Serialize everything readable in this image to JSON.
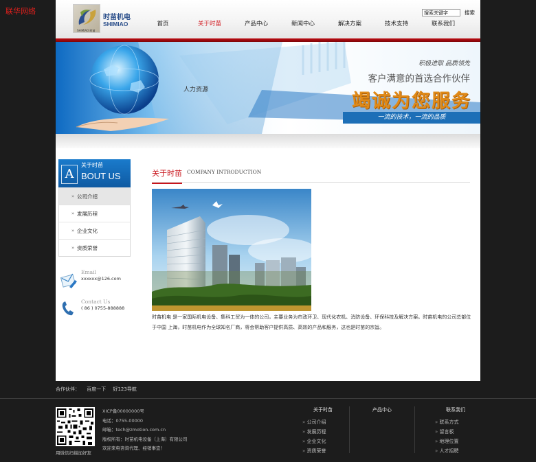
{
  "corner_brand": "联华网络",
  "logo": {
    "cn": "时苗机电",
    "en": "SHIMIAO",
    "tag": "SHIMIAO 时苗"
  },
  "nav": [
    {
      "label": "首页",
      "active": false
    },
    {
      "label": "关于时苗",
      "active": true
    },
    {
      "label": "产品中心",
      "active": false
    },
    {
      "label": "新闻中心",
      "active": false
    },
    {
      "label": "解决方案",
      "active": false
    },
    {
      "label": "技术支持",
      "active": false
    },
    {
      "label": "联系我们",
      "active": false
    }
  ],
  "search": {
    "value": "搜索关键字",
    "button": "搜索"
  },
  "banner": {
    "slogan1": "积极进取 品质领先",
    "slogan2": "客户满意的首选合作伙伴",
    "main": "竭诚为您服务",
    "strip": "一流的技术，一流的品质",
    "hr": "人力资源"
  },
  "sidebar": {
    "title_cn": "关于时苗",
    "title_letter": "A",
    "title_en": "BOUT US",
    "items": [
      {
        "label": "公司介绍",
        "active": true
      },
      {
        "label": "发展历程",
        "active": false
      },
      {
        "label": "企业文化",
        "active": false
      },
      {
        "label": "资质荣誉",
        "active": false
      }
    ],
    "email_label": "Email",
    "email_value": "xxxxxx@126.com",
    "contact_label": "Contact Us",
    "contact_value": "( 86 ) 0755-888888"
  },
  "main": {
    "title_cn": "关于时苗",
    "title_en": "COMPANY INTRODUCTION",
    "intro": "时苗机电 是一家国际机电设备、集科工贸为一体的公司，主要业务为市政环卫、现代化农机、消防设备、环保科技及解决方案。时苗机电的公司总部位于中国 上海，时苗机电作为全球知名厂商，将会帮助客户提供高质、高效的产品和服务，这也是时苗的宗旨。"
  },
  "partners": {
    "label": "合作伙伴：",
    "links": [
      "百度一下",
      "好123导航"
    ]
  },
  "footer": {
    "icp": "XICP备00000000号",
    "phone": "电话：0755-00000",
    "email": "邮箱：tech@zmotion.com.cn",
    "copyright": "版权所有：时苗机电设备（上海）有限公司",
    "welcome": "欢迎来电咨询代理、经销事宜！",
    "qr_caption": "用微信扫描加好友",
    "columns": [
      {
        "title": "关于时苗",
        "links": [
          "公司介绍",
          "发展历程",
          "企业文化",
          "资质荣誉"
        ]
      },
      {
        "title": "产品中心",
        "links": []
      },
      {
        "title": "联系我们",
        "links": [
          "联系方式",
          "留言板",
          "地理位置",
          "人才招聘"
        ]
      }
    ]
  },
  "colors": {
    "accent_red": "#c8141b",
    "brand_blue": "#1a7bcc",
    "banner_orange": "#e08a18"
  }
}
